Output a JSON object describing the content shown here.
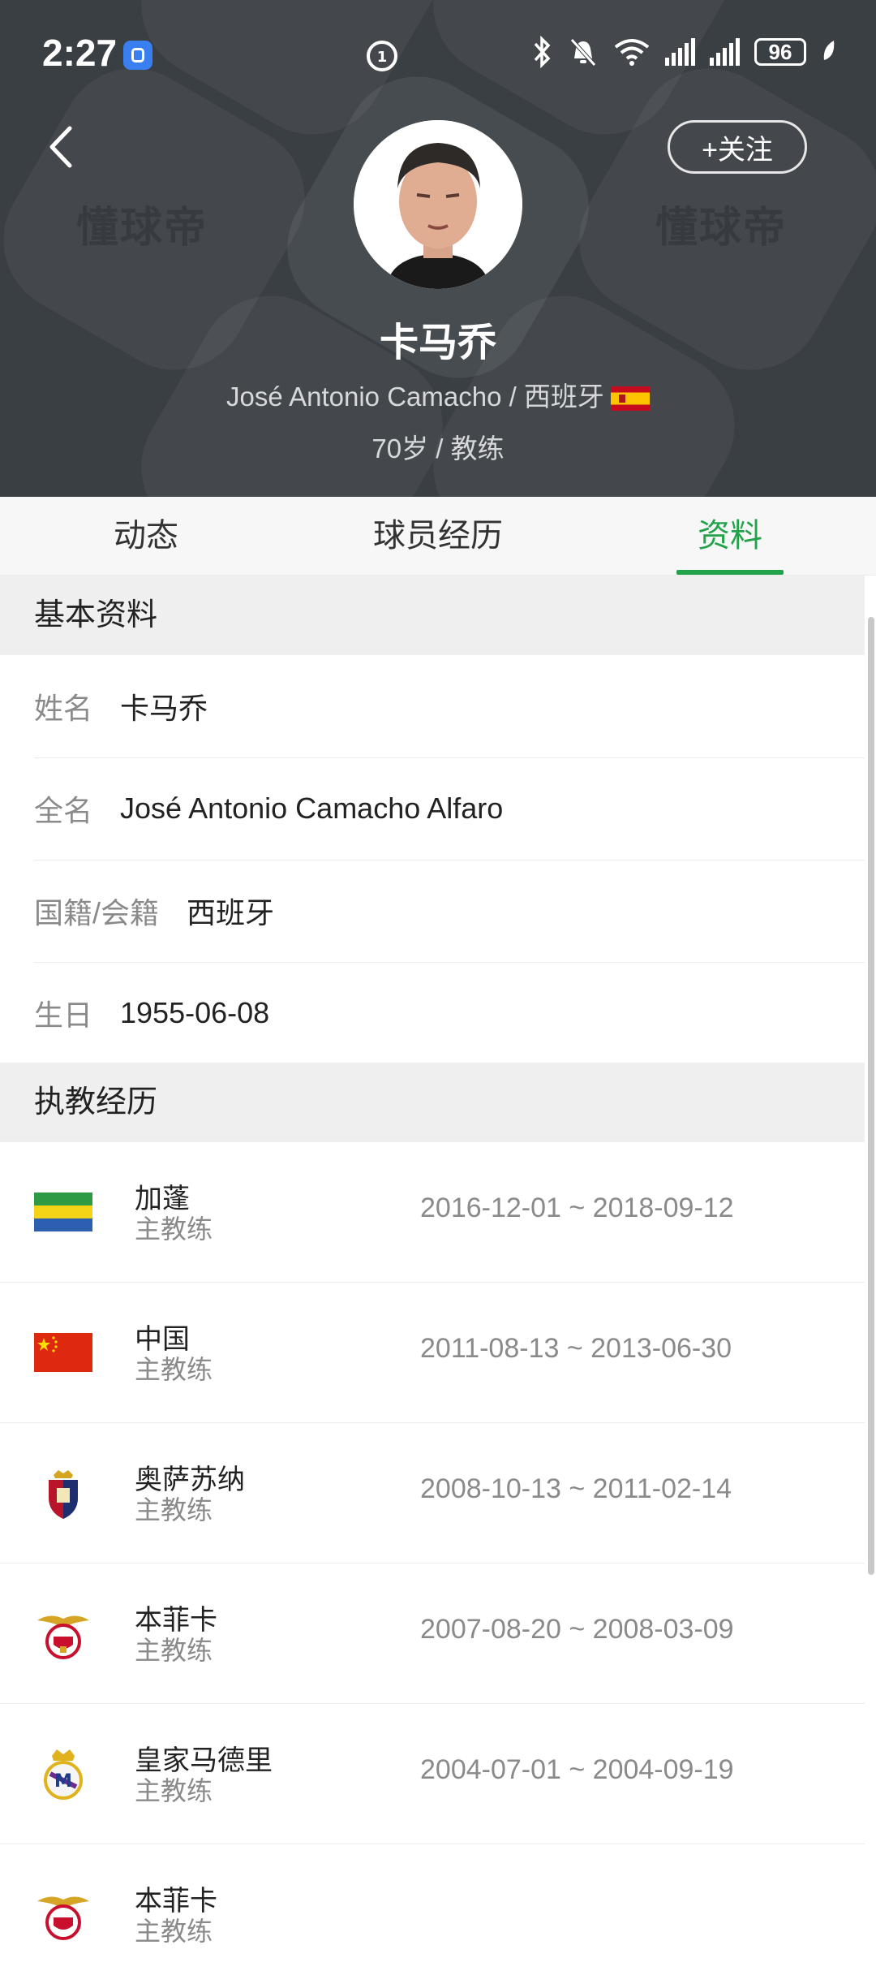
{
  "status_bar": {
    "time": "2:27",
    "battery": "96"
  },
  "header": {
    "follow_label": "+关注",
    "name": "卡马乔",
    "subtitle": "José Antonio Camacho / 西班牙",
    "meta": "70岁 / 教练",
    "watermark": "懂球帝"
  },
  "tabs": [
    {
      "label": "动态",
      "active": false
    },
    {
      "label": "球员经历",
      "active": false
    },
    {
      "label": "资料",
      "active": true
    }
  ],
  "basic_info": {
    "title": "基本资料",
    "rows": [
      {
        "label": "姓名",
        "value": "卡马乔"
      },
      {
        "label": "全名",
        "value": "José Antonio Camacho Alfaro"
      },
      {
        "label": "国籍/会籍",
        "value": "西班牙"
      },
      {
        "label": "生日",
        "value": "1955-06-08"
      }
    ]
  },
  "coaching": {
    "title": "执教经历",
    "items": [
      {
        "team": "加蓬",
        "role": "主教练",
        "period": "2016-12-01 ~ 2018-09-12",
        "logo": "gabon-flag"
      },
      {
        "team": "中国",
        "role": "主教练",
        "period": "2011-08-13 ~ 2013-06-30",
        "logo": "china-flag"
      },
      {
        "team": "奥萨苏纳",
        "role": "主教练",
        "period": "2008-10-13 ~ 2011-02-14",
        "logo": "osasuna-crest"
      },
      {
        "team": "本菲卡",
        "role": "主教练",
        "period": "2007-08-20 ~ 2008-03-09",
        "logo": "benfica-crest"
      },
      {
        "team": "皇家马德里",
        "role": "主教练",
        "period": "2004-07-01 ~ 2004-09-19",
        "logo": "real-madrid-crest"
      },
      {
        "team": "本菲卡",
        "role": "主教练",
        "period": "",
        "logo": "benfica-crest"
      }
    ]
  },
  "colors": {
    "accent": "#22a34a",
    "header_bg": "#3a3f44"
  }
}
